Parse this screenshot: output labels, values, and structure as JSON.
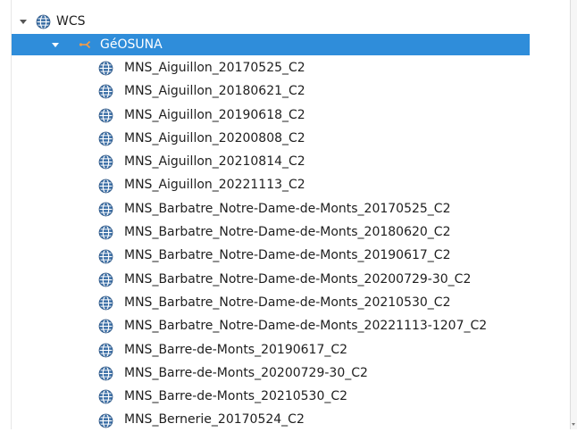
{
  "tree": {
    "root": {
      "label": "WCS",
      "icon": "globe-icon",
      "expanded": true
    },
    "provider": {
      "label": "GéOSUNA",
      "icon": "connection-icon",
      "expanded": true,
      "selected": true
    },
    "layers": [
      {
        "label": "MNS_Aiguillon_20170525_C2"
      },
      {
        "label": "MNS_Aiguillon_20180621_C2"
      },
      {
        "label": "MNS_Aiguillon_20190618_C2"
      },
      {
        "label": "MNS_Aiguillon_20200808_C2"
      },
      {
        "label": "MNS_Aiguillon_20210814_C2"
      },
      {
        "label": "MNS_Aiguillon_20221113_C2"
      },
      {
        "label": "MNS_Barbatre_Notre-Dame-de-Monts_20170525_C2"
      },
      {
        "label": "MNS_Barbatre_Notre-Dame-de-Monts_20180620_C2"
      },
      {
        "label": "MNS_Barbatre_Notre-Dame-de-Monts_20190617_C2"
      },
      {
        "label": "MNS_Barbatre_Notre-Dame-de-Monts_20200729-30_C2"
      },
      {
        "label": "MNS_Barbatre_Notre-Dame-de-Monts_20210530_C2"
      },
      {
        "label": "MNS_Barbatre_Notre-Dame-de-Monts_20221113-1207_C2"
      },
      {
        "label": "MNS_Barre-de-Monts_20190617_C2"
      },
      {
        "label": "MNS_Barre-de-Monts_20200729-30_C2"
      },
      {
        "label": "MNS_Barre-de-Monts_20210530_C2"
      },
      {
        "label": "MNS_Bernerie_20170524_C2"
      }
    ]
  },
  "colors": {
    "selection": "#2f8dda",
    "globe_fill": "#3a6ea5",
    "text": "#202020"
  }
}
